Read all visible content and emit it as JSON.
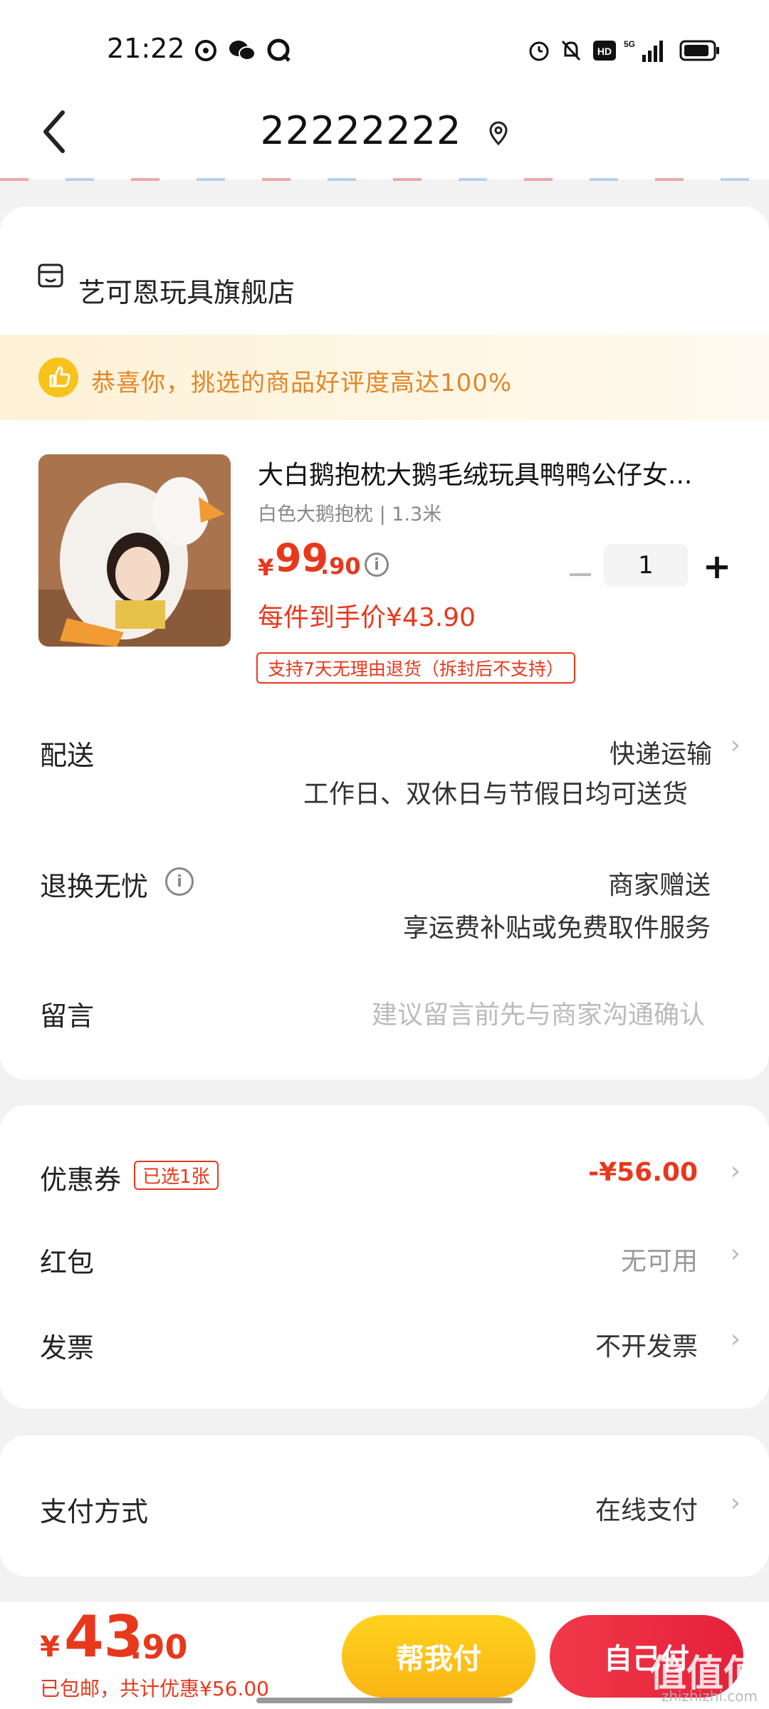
{
  "status_bar": {
    "time": "21:22",
    "network": "5G"
  },
  "header": {
    "title": "22222222"
  },
  "store": {
    "name": "艺可恩玩具旗舰店",
    "banner": "恭喜你，挑选的商品好评度高达100%"
  },
  "product": {
    "title": "大白鹅抱枕大鹅毛绒玩具鸭鸭公仔女...",
    "spec": "白色大鹅抱枕 | 1.3米",
    "price_currency": "¥",
    "price_int": "99",
    "price_dec": ".90",
    "per_price": "每件到手价¥43.90",
    "return_policy": "支持7天无理由退货（拆封后不支持）",
    "quantity": "1"
  },
  "delivery": {
    "label": "配送",
    "method": "快递运输",
    "note": "工作日、双休日与节假日均可送货"
  },
  "return_worry": {
    "label": "退换无忧",
    "value": "商家赠送",
    "note": "享运费补贴或免费取件服务"
  },
  "message": {
    "label": "留言",
    "placeholder": "建议留言前先与商家沟通确认"
  },
  "coupon": {
    "label": "优惠券",
    "tag": "已选1张",
    "value": "-¥56.00"
  },
  "red_packet": {
    "label": "红包",
    "value": "无可用"
  },
  "invoice": {
    "label": "发票",
    "value": "不开发票"
  },
  "payment": {
    "label": "支付方式",
    "value": "在线支付"
  },
  "bottom_bar": {
    "total_currency": "¥",
    "total_int": "43",
    "total_dec": ".90",
    "summary": "已包邮，共计优惠¥56.00",
    "help_pay_label": "帮我付",
    "self_pay_label": "自己付"
  },
  "watermark": {
    "main": "值值值",
    "sub": "zhizhizhi.com"
  },
  "colors": {
    "accent": "#e8381c",
    "help_button": "#fbbf17",
    "pay_button": "#e8283c",
    "banner_text": "#e3862a"
  }
}
